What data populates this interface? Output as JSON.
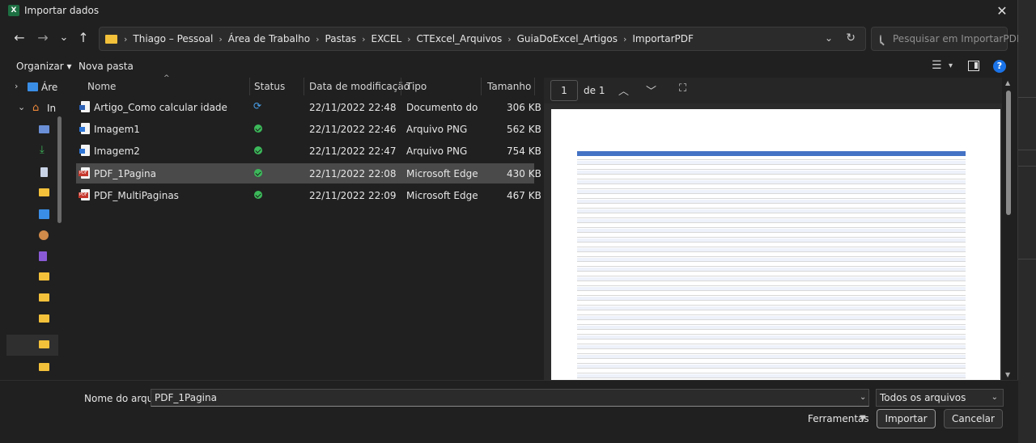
{
  "window": {
    "title": "Importar dados",
    "app_icon": "X",
    "close_glyph": "✕"
  },
  "nav": {
    "back": "←",
    "forward": "→",
    "recent": "⌄",
    "up": "↑",
    "breadcrumbs": [
      "Thiago – Pessoal",
      "Área de Trabalho",
      "Pastas",
      "EXCEL",
      "CTExcel_Arquivos",
      "GuiaDoExcel_Artigos",
      "ImportarPDF"
    ],
    "separator": "›",
    "address_dropdown": "⌄",
    "refresh": "↻",
    "search_placeholder": "Pesquisar em ImportarPDF"
  },
  "toolbar": {
    "organize": "Organizar ▾",
    "new_folder": "Nova pasta",
    "view_icon": "☰",
    "view_dropdown": "▾",
    "help": "?"
  },
  "sidebar": {
    "items": [
      {
        "label": "Áre",
        "chevron": "›",
        "kind": "desktop"
      },
      {
        "label": "In",
        "chevron": "⌄",
        "kind": "home"
      },
      {
        "label": "",
        "kind": "folder"
      },
      {
        "label": "",
        "kind": "downloads"
      },
      {
        "label": "",
        "kind": "documents"
      },
      {
        "label": "",
        "kind": "folder"
      },
      {
        "label": "",
        "kind": "pictures"
      },
      {
        "label": "",
        "kind": "music"
      },
      {
        "label": "",
        "kind": "videos"
      },
      {
        "label": "",
        "kind": "folder"
      },
      {
        "label": "",
        "kind": "folder"
      },
      {
        "label": "",
        "kind": "folder"
      },
      {
        "label": "",
        "kind": "folder"
      },
      {
        "label": "",
        "kind": "folder"
      }
    ]
  },
  "filelist": {
    "columns": {
      "name": "Nome",
      "status": "Status",
      "modified": "Data de modificação",
      "type": "Tipo",
      "size": "Tamanho"
    },
    "sort_indicator": "^",
    "files": [
      {
        "name": "Artigo_Como calcular idade",
        "icon": "word",
        "status": "sync",
        "modified": "22/11/2022 22:48",
        "type": "Documento do Mi...",
        "size": "306 KB",
        "selected": false
      },
      {
        "name": "Imagem1",
        "icon": "png",
        "status": "ok",
        "modified": "22/11/2022 22:46",
        "type": "Arquivo PNG",
        "size": "562 KB",
        "selected": false
      },
      {
        "name": "Imagem2",
        "icon": "png",
        "status": "ok",
        "modified": "22/11/2022 22:47",
        "type": "Arquivo PNG",
        "size": "754 KB",
        "selected": false
      },
      {
        "name": "PDF_1Pagina",
        "icon": "pdf",
        "status": "ok",
        "modified": "22/11/2022 22:08",
        "type": "Microsoft Edge PD...",
        "size": "430 KB",
        "selected": true
      },
      {
        "name": "PDF_MultiPaginas",
        "icon": "pdf",
        "status": "ok",
        "modified": "22/11/2022 22:09",
        "type": "Microsoft Edge PD...",
        "size": "467 KB",
        "selected": false
      }
    ]
  },
  "preview": {
    "page_number": "1",
    "page_of": "de 1",
    "prev": "︿",
    "next": "﹀",
    "fit": "⛶",
    "scroll_up": "▲",
    "scroll_down": "▼"
  },
  "bottom": {
    "filename_label": "Nome do arquivo:",
    "filename_value": "PDF_1Pagina",
    "filename_dropdown": "⌄",
    "filetype": "Todos os arquivos",
    "filetype_dropdown": "⌄",
    "tools": "Ferramentas",
    "tools_dropdown": "▼",
    "import": "Importar",
    "cancel": "Cancelar"
  },
  "colors": {
    "accent": "#1a73e8",
    "folder": "#f3c13a",
    "status_ok": "#3cb95a",
    "selected_row": "#4a4a4a"
  }
}
